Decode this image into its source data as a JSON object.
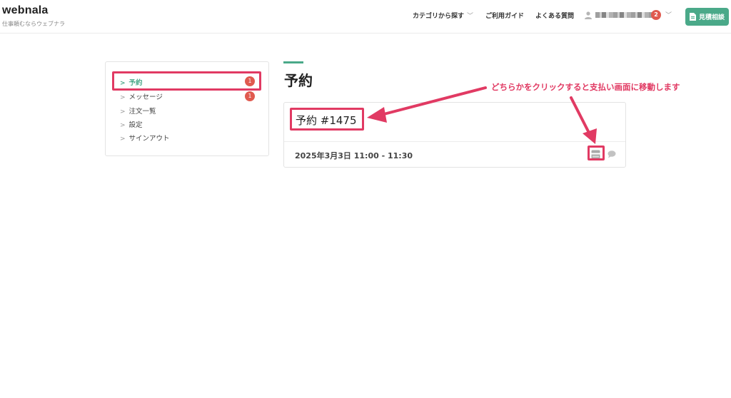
{
  "header": {
    "logo": "webnala",
    "tagline": "仕事頼むならウェブナラ",
    "nav": {
      "category": "カテゴリから探す",
      "guide": "ご利用ガイド",
      "faq": "よくある質問"
    },
    "user": {
      "notification_count": "2"
    },
    "estimate_button": "見積相談"
  },
  "sidebar": {
    "items": [
      {
        "label": "予約",
        "badge": "1"
      },
      {
        "label": "メッセージ",
        "badge": "1"
      },
      {
        "label": "注文一覧"
      },
      {
        "label": "設定"
      },
      {
        "label": "サインアウト"
      }
    ]
  },
  "main": {
    "title": "予約",
    "reservation": {
      "title": "予約 #1475",
      "datetime": "2025年3月3日 11:00 - 11:30"
    }
  },
  "annotation": {
    "text": "どちらかをクリックすると支払い画面に移動します",
    "color": "#e13a63"
  },
  "colors": {
    "accent": "#4aa989",
    "badge": "#e05a4f"
  },
  "icons": [
    "user-icon",
    "document-icon",
    "payment-icon",
    "chat-bubble-icon",
    "chevron-right-icon",
    "chevron-down-icon"
  ]
}
